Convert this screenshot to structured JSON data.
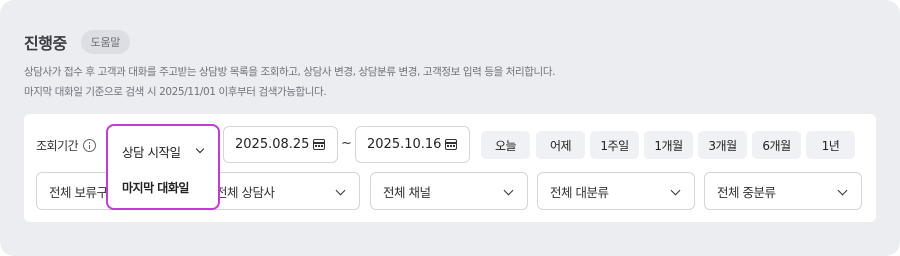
{
  "header": {
    "title": "진행중",
    "help_label": "도움말",
    "description_1": "상담사가 접수 후 고객과 대화를 주고받는 상담방 목록을 조회하고, 상담사 변경, 상담분류 변경, 고객정보 입력 등을 처리합니다.",
    "description_2": "마지막 대화일 기준으로 검색 시 2025/11/01 이후부터 검색가능합니다."
  },
  "filters": {
    "period_label": "조회기간",
    "date_type": {
      "selected": "상담 시작일",
      "options": [
        "마지막 대화일"
      ]
    },
    "start_date": "2025.08.25",
    "separator": "~",
    "end_date": "2025.10.16",
    "quick_ranges": [
      "오늘",
      "어제",
      "1주일",
      "1개월",
      "3개월",
      "6개월",
      "1년"
    ],
    "selects": [
      {
        "value": "전체 보류구분"
      },
      {
        "value": "전체 상담사"
      },
      {
        "value": "전체 채널"
      },
      {
        "value": "전체 대분류"
      },
      {
        "value": "전체 중분류"
      }
    ]
  },
  "colors": {
    "panel_bg": "#ecedf1",
    "dropdown_highlight": "#c43bd8"
  }
}
